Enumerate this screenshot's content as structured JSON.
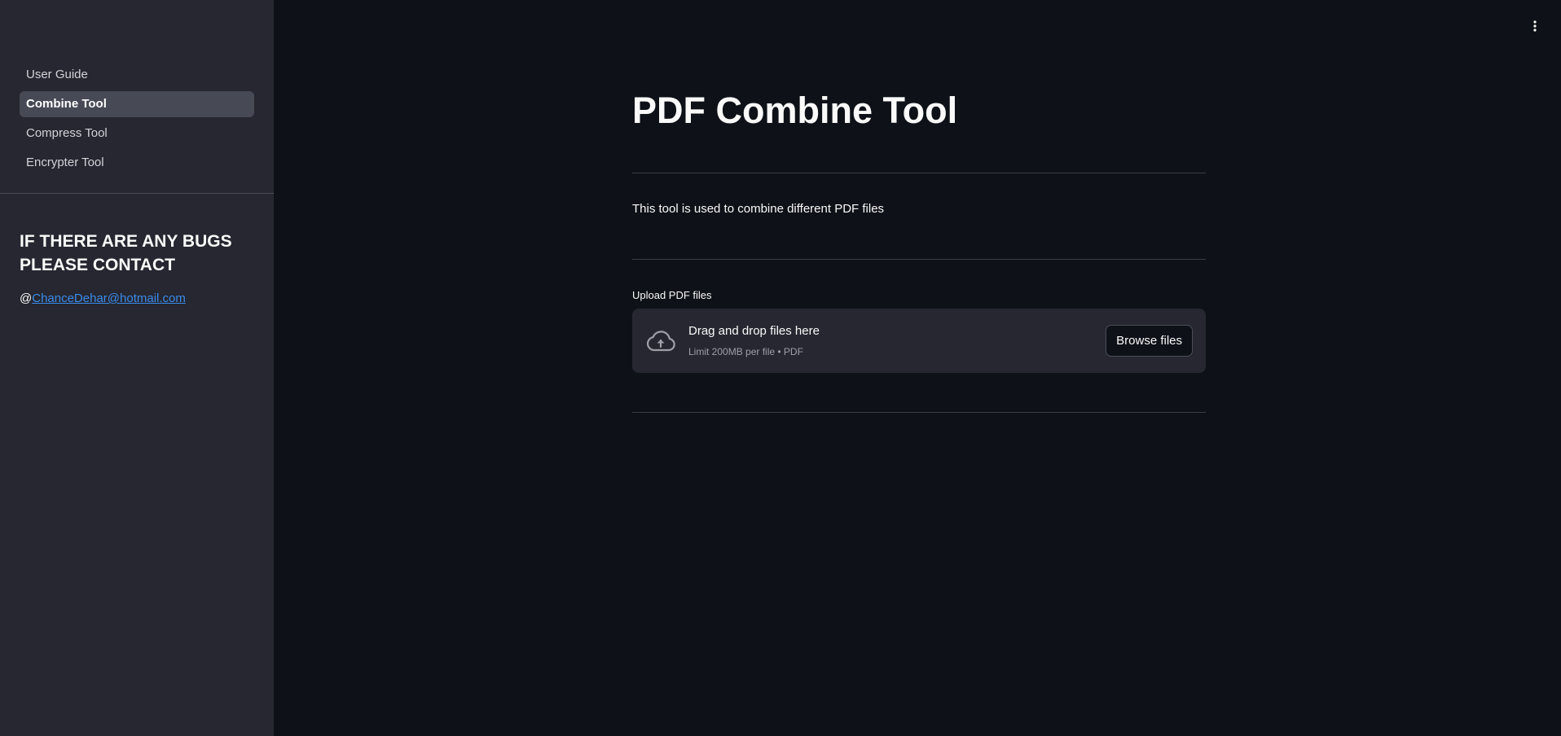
{
  "sidebar": {
    "nav": [
      {
        "label": "User Guide",
        "active": false
      },
      {
        "label": "Combine Tool",
        "active": true
      },
      {
        "label": "Compress Tool",
        "active": false
      },
      {
        "label": "Encrypter Tool",
        "active": false
      }
    ],
    "contact": {
      "heading": "IF THERE ARE ANY BUGS PLEASE CONTACT",
      "prefix": "@",
      "email": "ChanceDehar@hotmail.com"
    }
  },
  "header": {
    "menu_icon": "vertical-dots-icon"
  },
  "main": {
    "title": "PDF Combine Tool",
    "description": "This tool is used to combine different PDF files",
    "uploader": {
      "label": "Upload PDF files",
      "dropzone_title": "Drag and drop files here",
      "dropzone_subtitle": "Limit 200MB per file • PDF",
      "browse_label": "Browse files",
      "icon": "cloud-upload-icon"
    }
  },
  "colors": {
    "background": "#0e1117",
    "sidebar": "#262730",
    "active_nav": "#474955",
    "link": "#3b8beb"
  }
}
